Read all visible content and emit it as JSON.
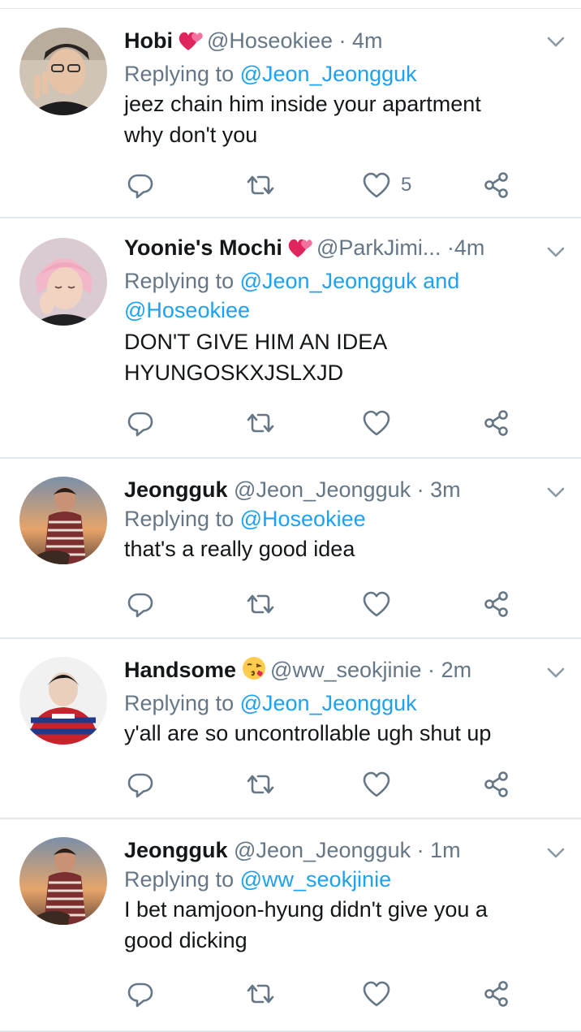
{
  "tweets": [
    {
      "name": "Hobi",
      "name_emoji": "two-hearts",
      "handle": "@Hoseokiee",
      "dot": "·",
      "time": "4m",
      "reply_prefix": "Replying to",
      "reply_mention": "@Jeon_Jeongguk",
      "text_line1": "jeez chain him inside your apartment",
      "text_line2": "why don't you",
      "like_count": "5"
    },
    {
      "name": "Yoonie's Mochi",
      "name_emoji": "two-hearts",
      "handle": "@ParkJimi...",
      "dot": "·",
      "time": "4m",
      "reply_prefix": "Replying to",
      "reply_mention": "@Jeon_Jeongguk",
      "reply_and": "and",
      "reply_mention2": "@Hoseokiee",
      "text_line1": "DON'T GIVE HIM AN IDEA",
      "text_line2": "HYUNGOSKXJSLXJD"
    },
    {
      "name": "Jeongguk",
      "handle": "@Jeon_Jeongguk",
      "dot": "·",
      "time": "3m",
      "reply_prefix": "Replying to",
      "reply_mention": "@Hoseokiee",
      "text_line1": "that's a really good idea"
    },
    {
      "name": "Handsome",
      "name_emoji": "face-blowing-kiss",
      "handle": "@ww_seokjinie",
      "dot": "·",
      "time": "2m",
      "reply_prefix": "Replying to",
      "reply_mention": "@Jeon_Jeongguk",
      "text_line1": "y'all are so uncontrollable ugh shut up"
    },
    {
      "name": "Jeongguk",
      "handle": "@Jeon_Jeongguk",
      "dot": "·",
      "time": "1m",
      "reply_prefix": "Replying to",
      "reply_mention": "@ww_seokjinie",
      "text_line1": "I bet namjoon-hyung didn't give you a",
      "text_line2": "good dicking"
    }
  ],
  "icons": {
    "reply": "reply-icon",
    "retweet": "retweet-icon",
    "like": "heart-icon",
    "share": "share-icon",
    "menu": "chevron-down-icon"
  },
  "colors": {
    "link": "#1da1f2",
    "secondary": "#657786",
    "divider": "#e1e8ed",
    "heart_emoji": "#e0245e"
  }
}
